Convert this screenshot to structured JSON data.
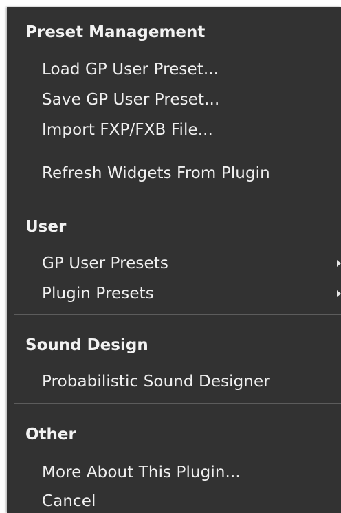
{
  "menu": {
    "sections": {
      "preset_management": {
        "header": "Preset Management",
        "items": {
          "load": "Load GP User Preset...",
          "save": "Save GP User Preset...",
          "import": "Import FXP/FXB File..."
        }
      },
      "refresh": {
        "items": {
          "refresh": "Refresh Widgets From Plugin"
        }
      },
      "user": {
        "header": "User",
        "items": {
          "gp_user_presets": "GP User Presets",
          "plugin_presets": "Plugin Presets"
        }
      },
      "sound_design": {
        "header": "Sound Design",
        "items": {
          "probabilistic": "Probabilistic Sound Designer"
        }
      },
      "other": {
        "header": "Other",
        "items": {
          "more_about": "More About This Plugin...",
          "cancel": "Cancel"
        }
      }
    },
    "icons": {
      "submenu_arrow": "chevron-right-icon"
    },
    "colors": {
      "background": "#323232",
      "text": "#f0f0f0",
      "separator": "#5c5c5c"
    }
  }
}
